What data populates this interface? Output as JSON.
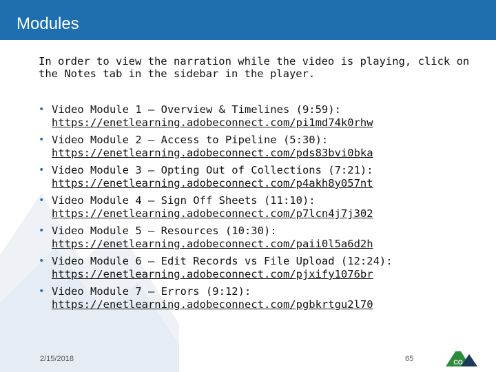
{
  "header": {
    "title": "Modules"
  },
  "intro": {
    "text": "In order to view the narration while the video is playing, click on the Notes tab in the sidebar in the player."
  },
  "modules": [
    {
      "title": "Video Module 1 – Overview & Timelines (9:59):",
      "url": "https://enetlearning.adobeconnect.com/pi1md74k0rhw"
    },
    {
      "title": "Video Module 2 – Access to Pipeline (5:30):",
      "url": "https://enetlearning.adobeconnect.com/pds83bvi0bka"
    },
    {
      "title": "Video Module 3 – Opting Out of Collections (7:21):",
      "url": "https://enetlearning.adobeconnect.com/p4akh8y057nt"
    },
    {
      "title": "Video Module 4 – Sign Off Sheets (11:10):",
      "url": "https://enetlearning.adobeconnect.com/p7lcn4j7j302"
    },
    {
      "title": "Video Module 5 – Resources (10:30):",
      "url": "https://enetlearning.adobeconnect.com/paii0l5a6d2h"
    },
    {
      "title": "Video Module 6 – Edit Records vs File Upload (12:24):",
      "url": "https://enetlearning.adobeconnect.com/pjxify1076br"
    },
    {
      "title": "Video Module 7 – Errors (9:12):",
      "url": "https://enetlearning.adobeconnect.com/pgbkrtgu2l70"
    }
  ],
  "footer": {
    "date": "2/15/2018",
    "page": "65"
  },
  "logo": {
    "label": "CO",
    "icon": "colorado-mountain-logo"
  },
  "colors": {
    "header_bg": "#1e6fb0",
    "logo_green": "#2e8b3a",
    "logo_dark": "#1c3b5a"
  }
}
